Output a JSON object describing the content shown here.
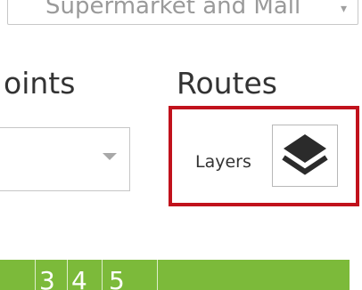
{
  "top_select": {
    "value": "Supermarket and Mall",
    "caret": "▾"
  },
  "tabs": {
    "points_label": "oints",
    "routes_label": "Routes"
  },
  "layers": {
    "label": "Layers",
    "icon": "layers-icon",
    "highlight_color": "#c1121c"
  },
  "bottom_bar": {
    "color": "#7cba3a",
    "cells": [
      "3",
      "4",
      "5"
    ]
  }
}
